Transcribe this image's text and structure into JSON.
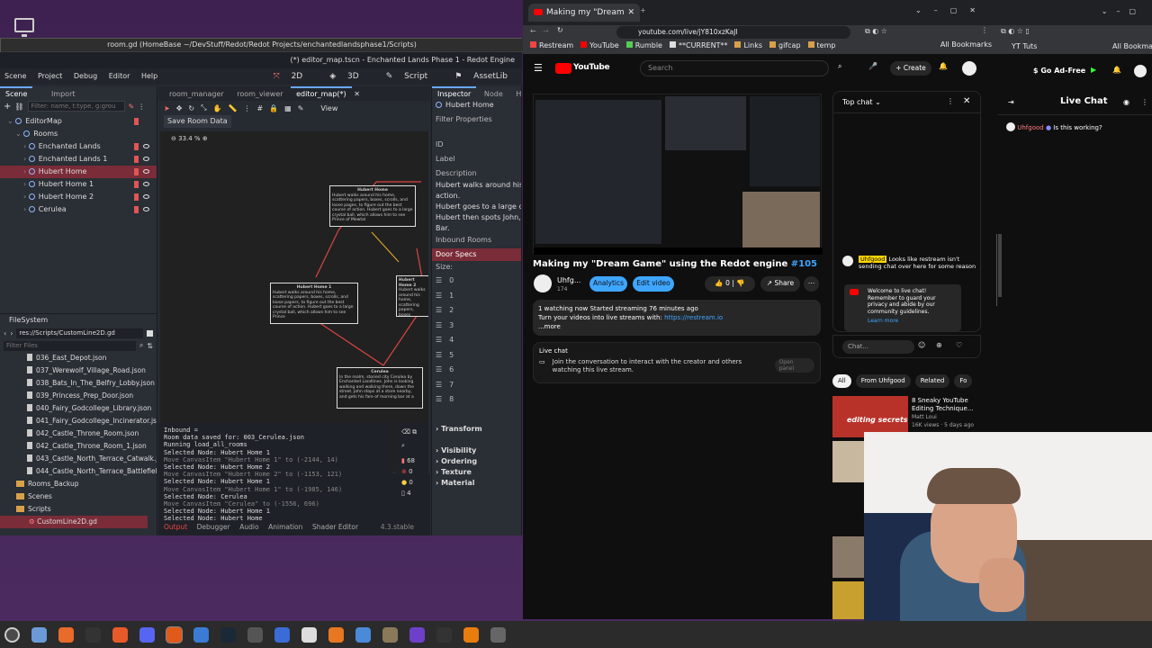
{
  "desktop": {
    "icon": "computer-icon"
  },
  "godot": {
    "outer_title": "room.gd (HomeBase ~/DevStuff/Redot/Redot Projects/enchantedlandsphase1/Scripts)",
    "title": "(*) editor_map.tscn - Enchanted Lands Phase 1 - Redot Engine",
    "menu": [
      "Scene",
      "Project",
      "Debug",
      "Editor",
      "Help"
    ],
    "workspaces": [
      "2D",
      "3D",
      "Script",
      "AssetLib"
    ],
    "scene_tabs": [
      "Scene",
      "Import"
    ],
    "filter_placeholder": "Filter: name, t:type, g:grou",
    "scene_tree": [
      {
        "label": "EditorMap",
        "depth": 0,
        "selected": false
      },
      {
        "label": "Rooms",
        "depth": 1,
        "selected": false
      },
      {
        "label": "Enchanted Lands",
        "depth": 2,
        "selected": false
      },
      {
        "label": "Enchanted Lands 1",
        "depth": 2,
        "selected": false
      },
      {
        "label": "Hubert Home",
        "depth": 2,
        "selected": true
      },
      {
        "label": "Hubert Home 1",
        "depth": 2,
        "selected": false
      },
      {
        "label": "Hubert Home 2",
        "depth": 2,
        "selected": false
      },
      {
        "label": "Cerulea",
        "depth": 2,
        "selected": false
      }
    ],
    "filesystem": {
      "title": "FileSystem",
      "path": "res://Scripts/CustomLine2D.gd",
      "filter": "Filter Files",
      "files": [
        "036_East_Depot.json",
        "037_Werewolf_Village_Road.json",
        "038_Bats_In_The_Belfry_Lobby.json",
        "039_Princess_Prep_Door.json",
        "040_Fairy_Godcollege_Library.json",
        "041_Fairy_Godcollege_Incinerator.js...",
        "042_Castle_Throne_Room.json",
        "042_Castle_Throne_Room_1.json",
        "043_Castle_North_Terrace_Catwalk.j...",
        "044_Castle_North_Terrace_Battlefiel..."
      ],
      "folders": [
        "Rooms_Backup",
        "Scenes",
        "Scripts"
      ],
      "selected_file": "CustomLine2D.gd"
    },
    "editor_tabs": [
      "room_manager",
      "room_viewer",
      "editor_map(*)"
    ],
    "view_label": "View",
    "save_room_btn": "Save Room Data",
    "zoom": "33.4 %",
    "nodes": {
      "top": {
        "title": "Hubert Home",
        "text": "Hubert walks around his home, scattering papers, boxes, scrolls, and loose pages, to figure out the best course of action. Hubert goes to a large crystal ball, which allows him to see Prince of Mewtal"
      },
      "left": {
        "title": "Hubert Home 1",
        "text": "Hubert walks around his home, scattering papers, boxes, scrolls, and loose papers, to figure out the best course of action. Hubert goes to a large crystal ball, which allows him to see Prince"
      },
      "bottom": {
        "title": "Cerulea",
        "text": "In the realm, storied city Cerulea by Enchanted Landlines. John is looking walking and walking there, down the street. John stops at a store nearby, and gets his fare of morning bar at a"
      },
      "right": {
        "title": "Hubert Home 2",
        "text": "Hubert walks around his home, scattering papers, boxes"
      }
    },
    "inspector": {
      "tabs": [
        "Inspector",
        "Node",
        "History"
      ],
      "node": "Hubert Home",
      "filter": "Filter Properties",
      "fields": [
        "ID",
        "Label",
        "Description"
      ],
      "description_lines": [
        "Hubert walks around his hom",
        "action.",
        "Hubert goes to a large crysta",
        "Hubert then spots John, pulls",
        "Bar."
      ],
      "inbound": "Inbound Rooms",
      "door_specs": "Door Specs",
      "size_label": "Size:",
      "doors": [
        "0",
        "1",
        "2",
        "3",
        "4",
        "5",
        "6",
        "7",
        "8"
      ],
      "sections": [
        "Transform",
        "Visibility",
        "Ordering",
        "Texture",
        "Material"
      ]
    },
    "console": {
      "lines": [
        {
          "t": "Inbound =",
          "dim": false
        },
        {
          "t": "Room data saved for: 003_Cerulea.json",
          "dim": false
        },
        {
          "t": "Running load_all_rooms",
          "dim": false
        },
        {
          "t": "Selected Node: Hubert Home 1",
          "dim": false
        },
        {
          "t": "Move CanvasItem \"Hubert Home 1\" to (-2144, 14)",
          "dim": true
        },
        {
          "t": "Selected Node: Hubert Home 2",
          "dim": false
        },
        {
          "t": "Move CanvasItem \"Hubert Home 2\" to (-1153, 121)",
          "dim": true
        },
        {
          "t": "Selected Node: Hubert Home 1",
          "dim": false
        },
        {
          "t": "Move CanvasItem \"Hubert Home 1\" to (-1985, 146)",
          "dim": true
        },
        {
          "t": "Selected Node: Cerulea",
          "dim": false
        },
        {
          "t": "Move CanvasItem \"Cerulea\" to (-1556, 696)",
          "dim": true
        },
        {
          "t": "Selected Node: Hubert Home 1",
          "dim": false
        },
        {
          "t": "Selected Node: Hubert Home",
          "dim": false
        }
      ],
      "badges": [
        "68",
        "0",
        "0",
        "4"
      ]
    },
    "bottom_tabs": [
      "Output",
      "Debugger",
      "Audio",
      "Animation",
      "Shader Editor"
    ],
    "version": "4.3.stable"
  },
  "chrome": {
    "tab_title": "Making my \"Dream",
    "url": "youtube.com/live/jY810xzKaJI",
    "bookmarks": [
      "Restream",
      "YouTube",
      "Rumble",
      "**CURRENT**",
      "Links",
      "gifcap",
      "temp"
    ],
    "all_bookmarks": "All Bookmarks"
  },
  "youtube": {
    "logo": "YouTube",
    "search_placeholder": "Search",
    "create": "Create",
    "title": "Making my \"Dream Game\" using the Redot engine",
    "hashtag": "#105",
    "channel": "Uhfg...",
    "subs": "174",
    "analytics": "Analytics",
    "edit_video": "Edit video",
    "likes": "0",
    "share": "Share",
    "watching": "1 watching now  Started streaming 76 minutes ago",
    "desc": "Turn your videos into live streams with",
    "desc_link": "https://restream.io",
    "more": "...more",
    "live_chat_label": "Live chat",
    "live_chat_msg": "Join the conversation to interact with the creator and others watching this live stream.",
    "open_panel": "Open panel",
    "top_chat": "Top chat",
    "chat_msg_user": "Uhfgood",
    "chat_msg_text": "Looks like restream isn't sending chat over here for some reason",
    "welcome": "Welcome to live chat! Remember to guard your privacy and abide by our community guidelines.",
    "learn_more": "Learn more",
    "chat_placeholder": "Chat...",
    "filters": [
      "All",
      "From Uhfgood",
      "Related",
      "Fo"
    ],
    "rec_title": "8 Sneaky YouTube Editing Technique...",
    "rec_channel": "Matt Loui",
    "rec_meta": "16K views · 5 days ago",
    "thumb_text": "editing secrets"
  },
  "chat2": {
    "tab": "YT Tuts",
    "all_bookmarks": "All Bookmark",
    "go_ad_free": "Go Ad-Free",
    "title": "Live Chat",
    "user": "Uhfgood",
    "message": "Is this working?"
  },
  "taskbar": [
    "menu-icon",
    "files-icon",
    "firefox-icon",
    "terminal-icon",
    "brave-icon",
    "discord-icon",
    "godot-icon",
    "bitwarden-icon",
    "steam-icon",
    "calculator-icon",
    "camera-icon",
    "chromium-icon",
    "vlc-icon",
    "mail-icon",
    "gimp-icon",
    "github-icon",
    "obs-icon",
    "blender-icon",
    "settings-icon"
  ]
}
